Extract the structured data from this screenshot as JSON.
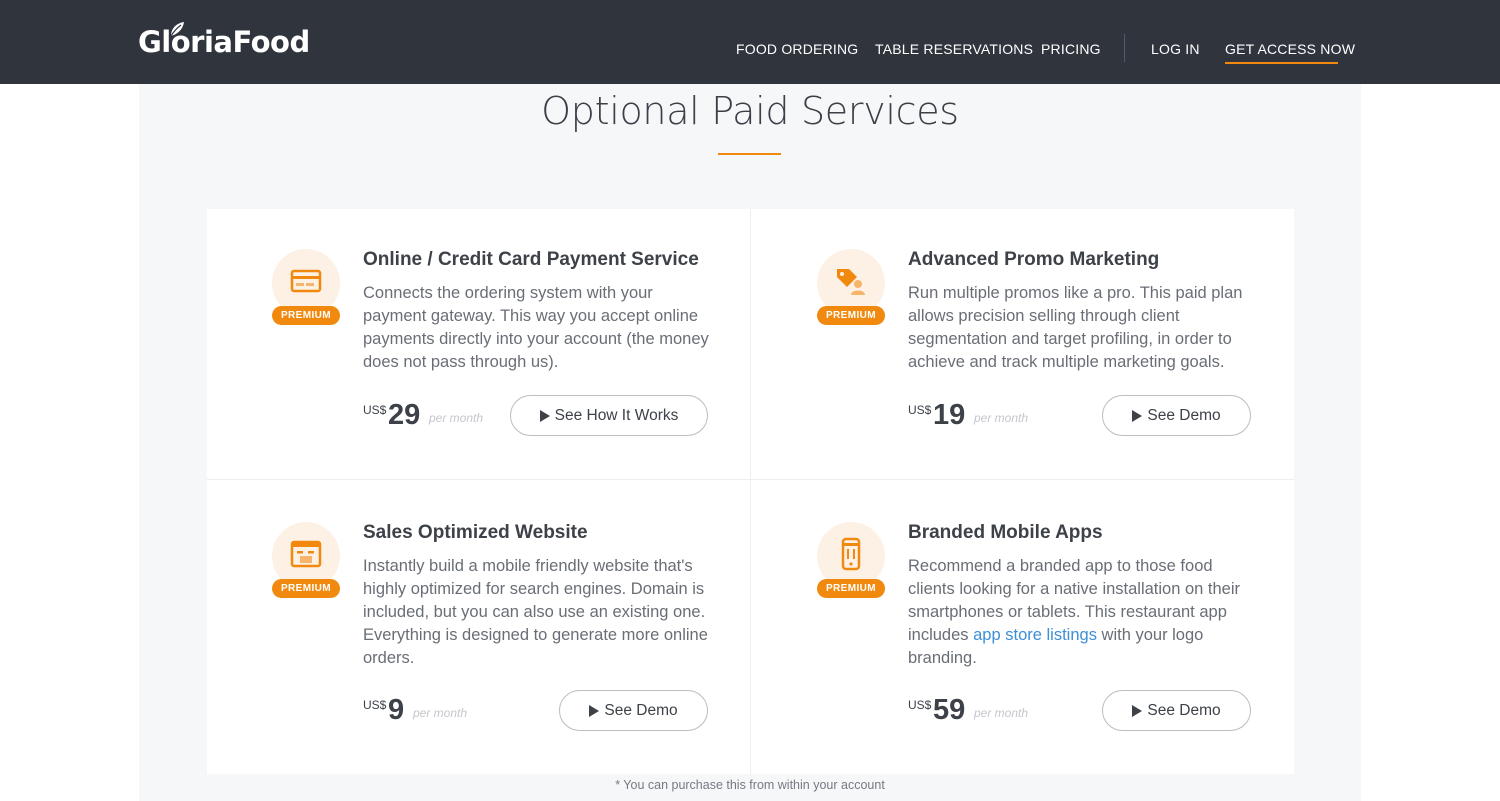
{
  "header": {
    "logo_text": "GloriaFood",
    "nav": [
      {
        "label": "FOOD ORDERING"
      },
      {
        "label": "TABLE RESERVATIONS"
      },
      {
        "label": "PRICING"
      },
      {
        "label": "LOG IN"
      },
      {
        "label": "GET ACCESS NOW"
      }
    ]
  },
  "page": {
    "title": "Optional Paid Services",
    "footnote": "* You can purchase this from within your account"
  },
  "services": [
    {
      "icon": "credit-card-icon",
      "badge": "PREMIUM",
      "title": "Online / Credit Card Payment Service",
      "description": "Connects the ordering system with your payment gateway. This way you accept online payments directly into your account (the money does not pass through us).",
      "currency": "US$",
      "price": "29",
      "period": "per month",
      "button": "See How It Works"
    },
    {
      "icon": "promo-tag-icon",
      "badge": "PREMIUM",
      "title": "Advanced Promo Marketing",
      "description": "Run multiple promos like a pro. This paid plan allows precision selling through client segmentation and target profiling, in order to achieve and track multiple marketing goals.",
      "currency": "US$",
      "price": "19",
      "period": "per month",
      "button": "See Demo"
    },
    {
      "icon": "website-icon",
      "badge": "PREMIUM",
      "title": "Sales Optimized Website",
      "description": "Instantly build a mobile friendly website that's highly optimized for search engines. Domain is included, but you can also use an existing one. Everything is designed to generate more online orders.",
      "currency": "US$",
      "price": "9",
      "period": "per month",
      "button": "See Demo"
    },
    {
      "icon": "mobile-app-icon",
      "badge": "PREMIUM",
      "title": "Branded Mobile Apps",
      "description_before": "Recommend a branded app to those food clients looking for a native installation on their smartphones or tablets. This restaurant app includes ",
      "description_link": "app store listings",
      "description_after": " with your logo branding.",
      "currency": "US$",
      "price": "59",
      "period": "per month",
      "button": "See Demo"
    }
  ],
  "colors": {
    "header_bg": "#2f343d",
    "accent": "#f0890e",
    "panel_bg": "#f6f7f9",
    "link": "#3d8fd6"
  }
}
